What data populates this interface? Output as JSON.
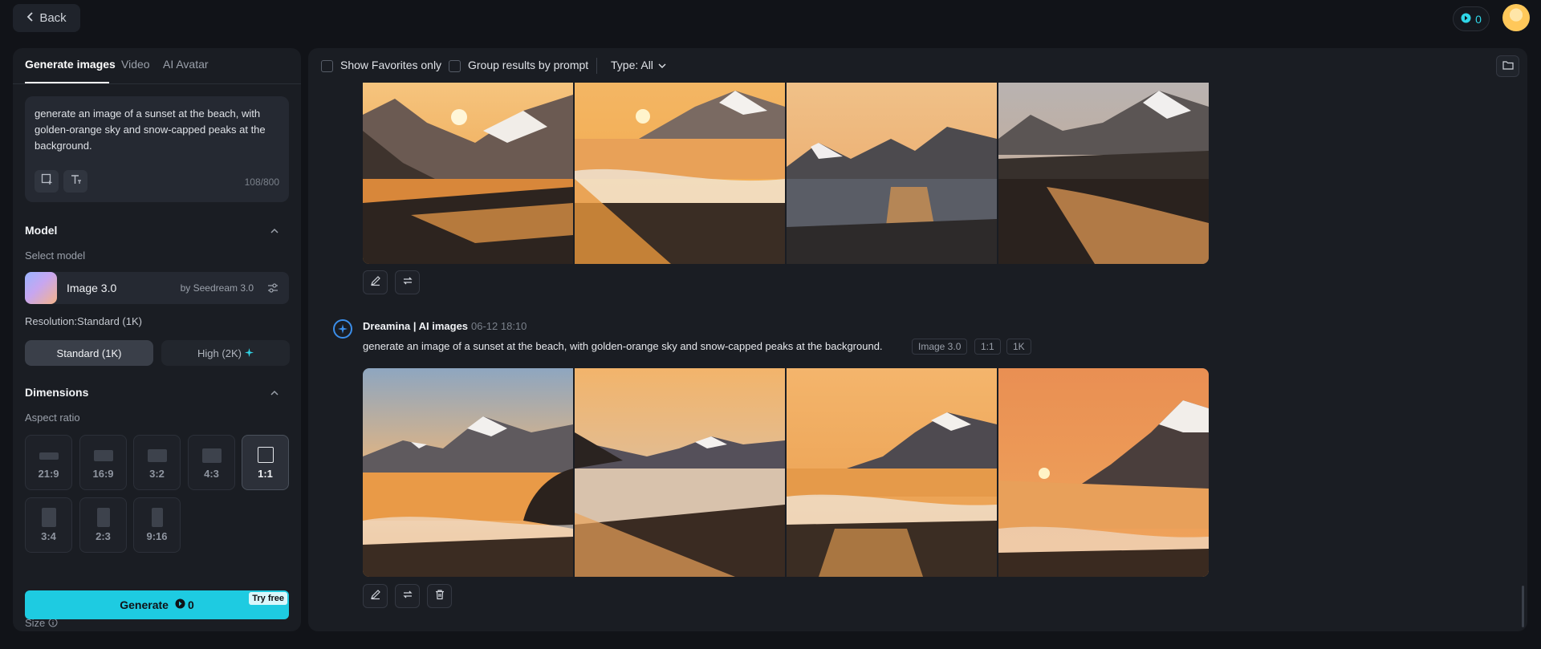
{
  "header": {
    "back_label": "Back",
    "credits": "0"
  },
  "left": {
    "tabs": [
      {
        "label": "Generate images",
        "active": true
      },
      {
        "label": "Video",
        "active": false
      },
      {
        "label": "AI Avatar",
        "active": false
      }
    ],
    "prompt": {
      "text": "generate an image of a sunset at the beach, with golden-orange sky and snow-capped peaks at the background.",
      "count": "108/800"
    },
    "model": {
      "section_title": "Model",
      "select_label": "Select model",
      "name": "Image 3.0",
      "by": "by Seedream 3.0"
    },
    "resolution": {
      "label": "Resolution:Standard (1K)",
      "standard": "Standard (1K)",
      "high": "High (2K)"
    },
    "dimensions": {
      "section_title": "Dimensions",
      "aspect_label": "Aspect ratio",
      "ratios": [
        {
          "label": "21:9",
          "active": false
        },
        {
          "label": "16:9",
          "active": false
        },
        {
          "label": "3:2",
          "active": false
        },
        {
          "label": "4:3",
          "active": false
        },
        {
          "label": "1:1",
          "active": true
        },
        {
          "label": "3:4",
          "active": false
        },
        {
          "label": "2:3",
          "active": false
        },
        {
          "label": "9:16",
          "active": false
        }
      ],
      "size_label": "Size"
    },
    "generate": {
      "label": "Generate",
      "cost": "0",
      "badge": "Try free"
    }
  },
  "right": {
    "filters": {
      "favorites": "Show Favorites only",
      "group": "Group results by prompt",
      "type": "Type: All"
    },
    "generation": {
      "author": "Dreamina | AI images",
      "time": "06-12  18:10",
      "prompt": "generate an image of a sunset at the beach, with golden-orange sky and snow-capped peaks at the background.",
      "tags": [
        "Image 3.0",
        "1:1",
        "1K"
      ]
    }
  }
}
